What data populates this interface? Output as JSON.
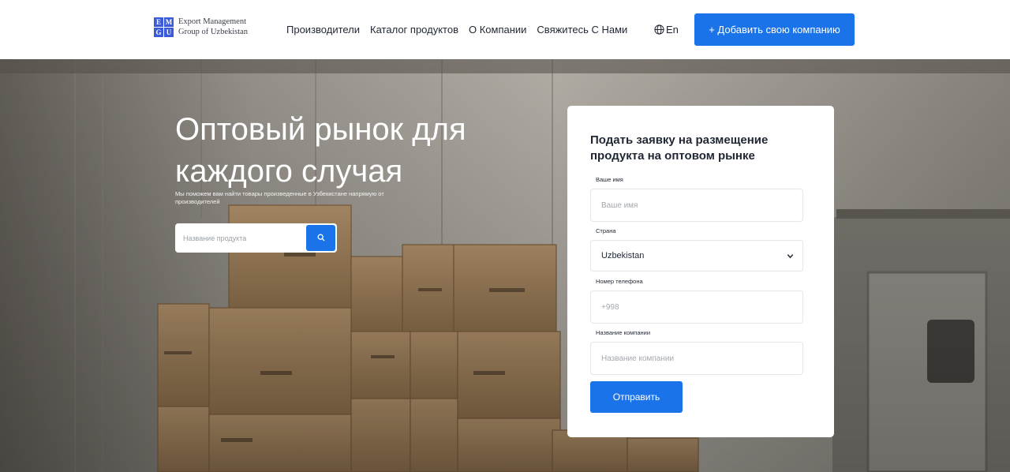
{
  "header": {
    "logo": {
      "letters": [
        "E",
        "M",
        "G",
        "U"
      ],
      "line1": "Export Management",
      "line2": "Group of Uzbekistan"
    },
    "nav": [
      {
        "label": "Производители"
      },
      {
        "label": "Каталог продуктов"
      },
      {
        "label": "О Компании"
      },
      {
        "label": "Свяжитесь С Нами"
      }
    ],
    "language": {
      "icon": "globe-icon",
      "label": "En"
    },
    "add_company_label": "+ Добавить свою компанию"
  },
  "hero": {
    "title": "Оптовый рынок для каждого случая",
    "subtitle": "Мы поможем вам найти товары произведенные в Узбекистане напрямую от производителей",
    "search": {
      "placeholder": "Название продукта",
      "icon": "search-icon"
    }
  },
  "form": {
    "title": "Подать заявку на размещение продукта на оптовом рынке",
    "name": {
      "label": "Ваше имя",
      "placeholder": "Ваше имя"
    },
    "country": {
      "label": "Страна",
      "value": "Uzbekistan",
      "icon": "chevron-down-icon"
    },
    "phone": {
      "label": "Номер телефона",
      "placeholder": "+998"
    },
    "company": {
      "label": "Название компании",
      "placeholder": "Название компании"
    },
    "submit_label": "Отправить"
  },
  "colors": {
    "accent": "#1a73e8",
    "logo_blue": "#3b5bdb",
    "text": "#1f2733"
  }
}
